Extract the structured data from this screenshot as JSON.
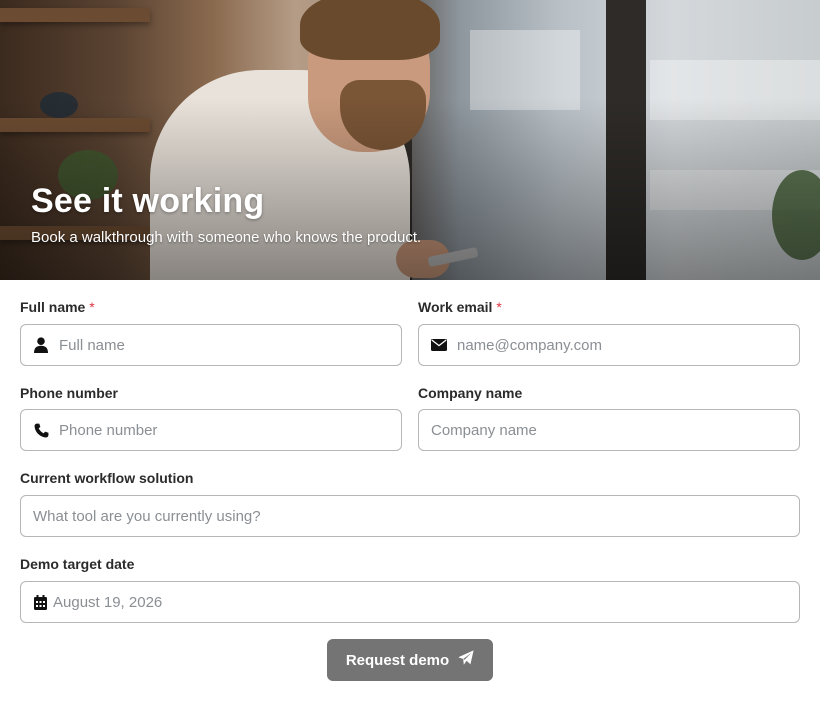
{
  "hero": {
    "title": "See it working",
    "subtitle": "Book a walkthrough with someone who knows the product."
  },
  "form": {
    "required_marker": "*",
    "full_name": {
      "label": "Full name",
      "placeholder": "Full name",
      "required": true,
      "icon": "user-icon"
    },
    "work_email": {
      "label": "Work email",
      "placeholder": "name@company.com",
      "required": true,
      "icon": "envelope-icon"
    },
    "phone": {
      "label": "Phone number",
      "placeholder": "Phone number",
      "icon": "phone-icon"
    },
    "company": {
      "label": "Company name",
      "placeholder": "Company name"
    },
    "workflow": {
      "label": "Current workflow solution",
      "placeholder": "What tool are you currently using?"
    },
    "demo_date": {
      "label": "Demo target date",
      "value": "August 19, 2026",
      "icon": "calendar-icon"
    },
    "submit": {
      "label": "Request demo",
      "icon": "paper-plane-icon"
    }
  },
  "colors": {
    "required": "#dc3545",
    "button_bg": "#747474",
    "input_border": "#b6b6b6",
    "placeholder": "#8a8f94"
  }
}
